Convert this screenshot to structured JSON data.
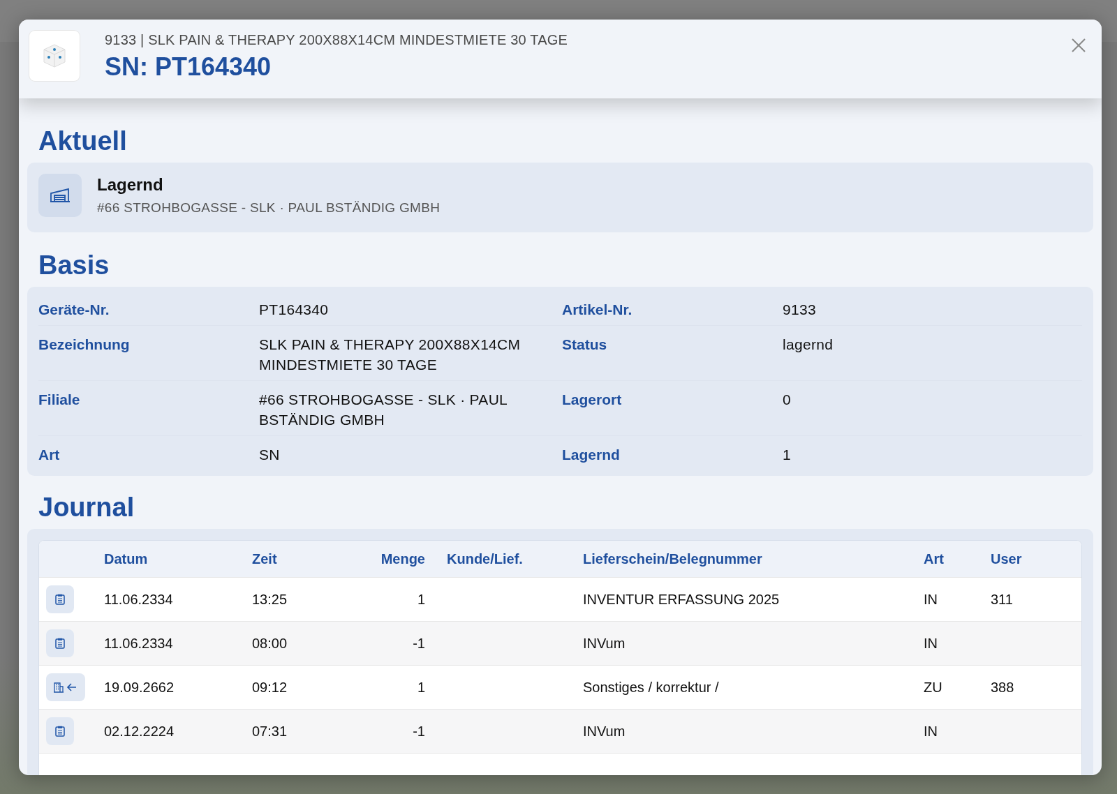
{
  "header": {
    "subtitle": "9133 | SLK PAIN & THERAPY 200X88X14CM MINDESTMIETE 30 TAGE",
    "title": "SN: PT164340"
  },
  "current": {
    "heading": "Aktuell",
    "status": "Lagernd",
    "location": "#66 STROHBOGASSE - SLK · PAUL BSTÄNDIG GMBH"
  },
  "basis": {
    "heading": "Basis",
    "rows": [
      [
        {
          "label": "Geräte-Nr.",
          "value": "PT164340"
        },
        {
          "label": "Artikel-Nr.",
          "value": "9133"
        }
      ],
      [
        {
          "label": "Bezeichnung",
          "value": "SLK PAIN & THERAPY 200X88X14CM MINDESTMIETE 30 TAGE"
        },
        {
          "label": "Status",
          "value": "lagernd"
        }
      ],
      [
        {
          "label": "Filiale",
          "value": "#66 STROHBOGASSE - SLK · PAUL BSTÄNDIG GMBH"
        },
        {
          "label": "Lagerort",
          "value": "0"
        }
      ],
      [
        {
          "label": "Art",
          "value": "SN"
        },
        {
          "label": "Lagernd",
          "value": "1"
        }
      ]
    ]
  },
  "journal": {
    "heading": "Journal",
    "columns": [
      "Datum",
      "Zeit",
      "Menge",
      "Kunde/Lief.",
      "Lieferschein/Belegnummer",
      "Art",
      "User"
    ],
    "rows": [
      {
        "kind": "clipboard",
        "cells": [
          "11.06.2334",
          "13:25",
          "1",
          "",
          "INVENTUR ERFASSUNG 2025",
          "IN",
          "311"
        ]
      },
      {
        "kind": "clipboard",
        "cells": [
          "11.06.2334",
          "08:00",
          "-1",
          "",
          "INVum",
          "IN",
          ""
        ]
      },
      {
        "kind": "building-in",
        "cells": [
          "19.09.2662",
          "09:12",
          "1",
          "",
          "Sonstiges / korrektur /",
          "ZU",
          "388"
        ]
      },
      {
        "kind": "clipboard",
        "cells": [
          "02.12.2224",
          "07:31",
          "-1",
          "",
          "INVum",
          "IN",
          ""
        ]
      }
    ]
  }
}
